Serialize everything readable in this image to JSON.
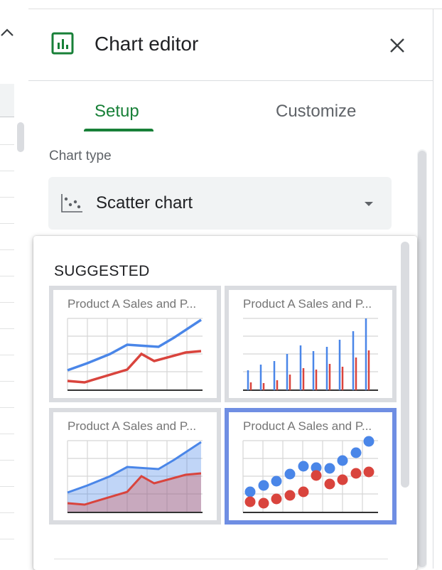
{
  "panel": {
    "title": "Chart editor",
    "icons": {
      "chart": "chart-editor-icon",
      "close": "close-icon"
    }
  },
  "tabs": [
    {
      "label": "Setup",
      "active": true
    },
    {
      "label": "Customize",
      "active": false
    }
  ],
  "chart_type": {
    "label": "Chart type",
    "value": "Scatter chart",
    "icon": "scatter-chart-icon"
  },
  "dropdown": {
    "section_label": "SUGGESTED",
    "options": [
      {
        "title": "Product A Sales and P...",
        "kind": "line",
        "selected": false
      },
      {
        "title": "Product A Sales and P...",
        "kind": "column",
        "selected": false
      },
      {
        "title": "Product A Sales and P...",
        "kind": "area",
        "selected": false
      },
      {
        "title": "Product A Sales and P...",
        "kind": "scatter",
        "selected": true
      }
    ]
  },
  "colors": {
    "accent_green": "#188038",
    "selected_border": "#6f8ee3",
    "series_blue": "#4a86e8",
    "series_red": "#d9443d"
  }
}
